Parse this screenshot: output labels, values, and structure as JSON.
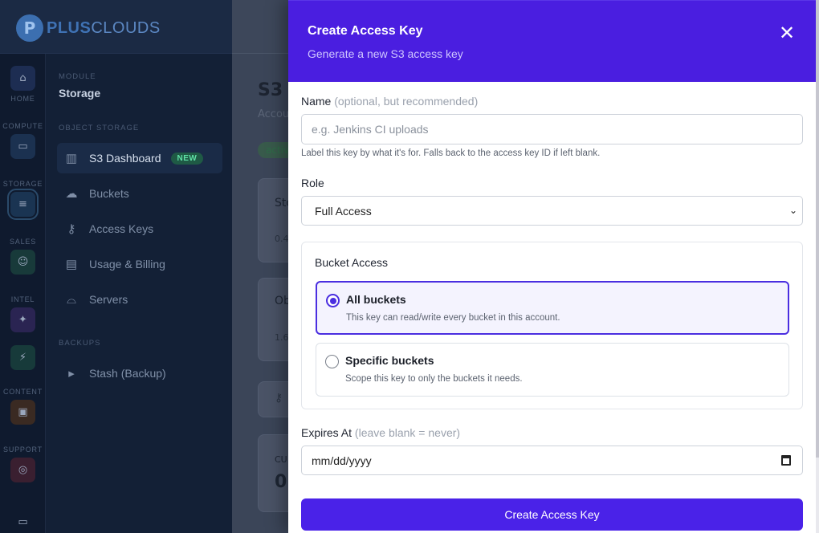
{
  "brand": {
    "mark": "P",
    "name_bold": "PLUS",
    "name_light": "CLOUDS"
  },
  "rail": {
    "items": [
      {
        "label": "HOME",
        "glyph": "⌂"
      },
      {
        "label": "COMPUTE",
        "glyph": "▭"
      },
      {
        "label": "STORAGE",
        "glyph": "≡"
      },
      {
        "label": "SALES",
        "glyph": "☺"
      },
      {
        "label": "INTEL",
        "glyph": "✦"
      },
      {
        "label": "",
        "glyph": "⚡"
      },
      {
        "label": "CONTENT",
        "glyph": "▣"
      },
      {
        "label": "SUPPORT",
        "glyph": "◎"
      },
      {
        "label": "",
        "glyph": "▭"
      }
    ]
  },
  "sidebar": {
    "module_label": "MODULE",
    "module_name": "Storage",
    "section_object": "OBJECT STORAGE",
    "items": [
      {
        "label": "S3 Dashboard",
        "badge": "NEW",
        "icon": "bar-chart-icon"
      },
      {
        "label": "Buckets",
        "icon": "cloud-icon"
      },
      {
        "label": "Access Keys",
        "icon": "key-icon"
      },
      {
        "label": "Usage & Billing",
        "icon": "money-icon"
      },
      {
        "label": "Servers",
        "icon": "server-icon"
      }
    ],
    "section_backups": "BACKUPS",
    "backup_items": [
      {
        "label": "Stash (Backup)",
        "icon": "terminal-icon"
      }
    ]
  },
  "main": {
    "title_partial": "S3 (",
    "subtitle_partial": "Accou",
    "pill_partial": "activ",
    "cards": [
      {
        "title": "Sto",
        "value": "0.4"
      },
      {
        "title": "Ob",
        "value": "1.6"
      },
      {
        "title": "",
        "value": ""
      },
      {
        "title": "CU",
        "value": "0"
      }
    ]
  },
  "modal": {
    "title": "Create Access Key",
    "subtitle": "Generate a new S3 access key",
    "close_icon": "close-icon",
    "name_label": "Name",
    "name_hint": "(optional, but recommended)",
    "name_placeholder": "e.g. Jenkins CI uploads",
    "name_value": "",
    "name_help": "Label this key by what it's for. Falls back to the access key ID if left blank.",
    "role_label": "Role",
    "role_selected": "Full Access",
    "bucket_access_label": "Bucket Access",
    "options": [
      {
        "title": "All buckets",
        "desc": "This key can read/write every bucket in this account.",
        "selected": true
      },
      {
        "title": "Specific buckets",
        "desc": "Scope this key to only the buckets it needs.",
        "selected": false
      }
    ],
    "expires_label": "Expires At",
    "expires_hint": "(leave blank = never)",
    "expires_placeholder": "mm/dd/yyyy",
    "submit_label": "Create Access Key"
  },
  "colors": {
    "accent": "#4a22e8",
    "header": "#4a1ee0",
    "sidebar_bg": "#132036"
  }
}
